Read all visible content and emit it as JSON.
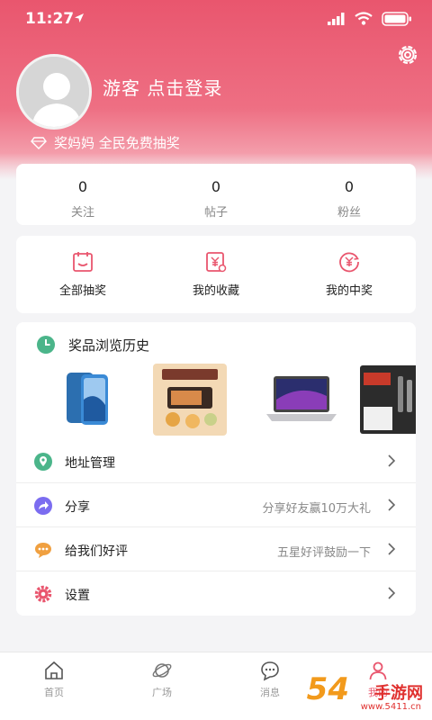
{
  "status_bar": {
    "time": "11:27"
  },
  "profile": {
    "login_prompt": "游客 点击登录",
    "banner": "奖妈妈 全民免费抽奖"
  },
  "stats": [
    {
      "value": "0",
      "label": "关注"
    },
    {
      "value": "0",
      "label": "帖子"
    },
    {
      "value": "0",
      "label": "粉丝"
    }
  ],
  "quick_actions": [
    {
      "label": "全部抽奖",
      "icon": "calendar-icon"
    },
    {
      "label": "我的收藏",
      "icon": "yen-card-icon"
    },
    {
      "label": "我的中奖",
      "icon": "yen-circle-icon"
    }
  ],
  "history": {
    "title": "奖品浏览历史",
    "items": [
      "iPhone",
      "宝宝专属菜单",
      "MacBook",
      "真空电锅"
    ]
  },
  "menu": [
    {
      "label": "地址管理",
      "hint": "",
      "icon": "location-icon",
      "color": "#4bb58a"
    },
    {
      "label": "分享",
      "hint": "分享好友赢10万大礼",
      "icon": "share-icon",
      "color": "#7b6cf0"
    },
    {
      "label": "给我们好评",
      "hint": "五星好评鼓励一下",
      "icon": "comment-icon",
      "color": "#f0a040"
    },
    {
      "label": "设置",
      "hint": "",
      "icon": "gear-icon",
      "color": "#e9566e"
    }
  ],
  "tabbar": [
    {
      "label": "首页",
      "icon": "home-icon"
    },
    {
      "label": "广场",
      "icon": "planet-icon"
    },
    {
      "label": "消息",
      "icon": "message-icon"
    },
    {
      "label": "我的",
      "icon": "user-icon"
    }
  ],
  "watermark": {
    "number": "54",
    "text": "手游网",
    "url": "www.5411.cn"
  },
  "colors": {
    "brand": "#e9566e",
    "accent_green": "#4bb58a",
    "accent_purple": "#7b6cf0",
    "accent_orange": "#f0a040"
  }
}
